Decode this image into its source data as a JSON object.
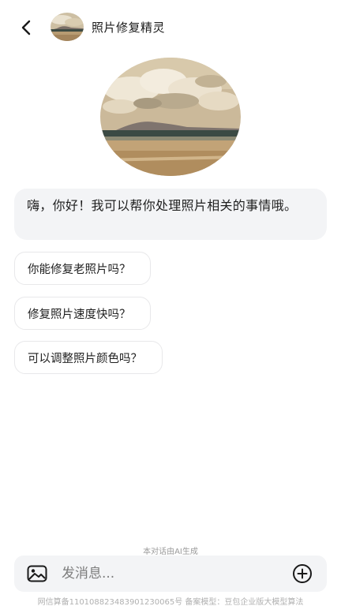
{
  "header": {
    "title": "照片修复精灵",
    "back_icon": "chevron-left-icon",
    "avatar": "landscape-avatar"
  },
  "hero": {
    "avatar": "landscape-avatar-large"
  },
  "chat": {
    "greeting": "嗨，你好！我可以帮你处理照片相关的事情哦。"
  },
  "suggestions": [
    {
      "label": "你能修复老照片吗？"
    },
    {
      "label": "修复照片速度快吗？"
    },
    {
      "label": "可以调整照片颜色吗？"
    }
  ],
  "notice": {
    "ai_generated": "本对话由AI生成"
  },
  "composer": {
    "placeholder": "发消息...",
    "image_icon": "image-icon",
    "plus_icon": "plus-circle-icon"
  },
  "footer": {
    "text": "网信算备110108823483901230065号 备案模型：豆包企业版大模型算法"
  },
  "colors": {
    "bubble_bg": "#f3f4f6",
    "chip_border": "#e8e8ea",
    "text": "#1a1a1a",
    "muted": "#9a9a9a"
  }
}
